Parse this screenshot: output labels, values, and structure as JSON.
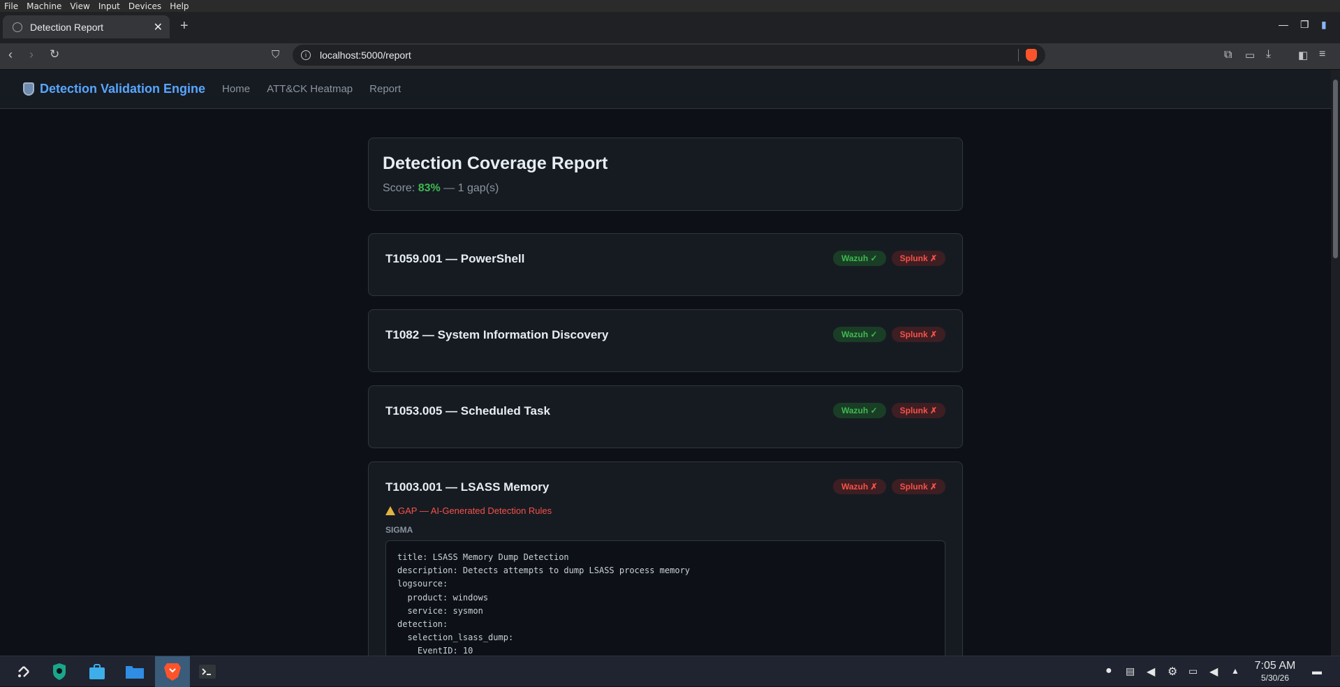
{
  "vm_menu": [
    "File",
    "Machine",
    "View",
    "Input",
    "Devices",
    "Help"
  ],
  "browser": {
    "tab_title": "Detection Report",
    "url": "localhost:5000/report"
  },
  "nav": {
    "brand": "Detection Validation Engine",
    "links": [
      "Home",
      "ATT&CK Heatmap",
      "Report"
    ]
  },
  "report": {
    "title": "Detection Coverage Report",
    "score_prefix": "Score: ",
    "score": "83%",
    "score_suffix": " — 1 gap(s)"
  },
  "techniques": [
    {
      "title": "T1059.001 — PowerShell",
      "wazuh": "Wazuh ✓",
      "splunk": "Splunk ✗"
    },
    {
      "title": "T1082 — System Information Discovery",
      "wazuh": "Wazuh ✓",
      "splunk": "Splunk ✗"
    },
    {
      "title": "T1053.005 — Scheduled Task",
      "wazuh": "Wazuh ✓",
      "splunk": "Splunk ✗"
    },
    {
      "title": "T1003.001 — LSASS Memory",
      "wazuh": "Wazuh ✗",
      "splunk": "Splunk ✗",
      "gap_text": "GAP — AI-Generated Detection Rules",
      "sigma_label": "SIGMA",
      "sigma_code": "title: LSASS Memory Dump Detection\ndescription: Detects attempts to dump LSASS process memory\nlogsource:\n  product: windows\n  service: sysmon\ndetection:\n  selection_lsass_dump:\n    EventID: 10"
    }
  ],
  "taskbar": {
    "time": "7:05 AM",
    "date": "5/30/26"
  },
  "colors": {
    "accent": "#58a6ff",
    "ok": "#3fb950",
    "fail": "#f85149",
    "bg": "#0d1117",
    "card": "#161b22"
  }
}
